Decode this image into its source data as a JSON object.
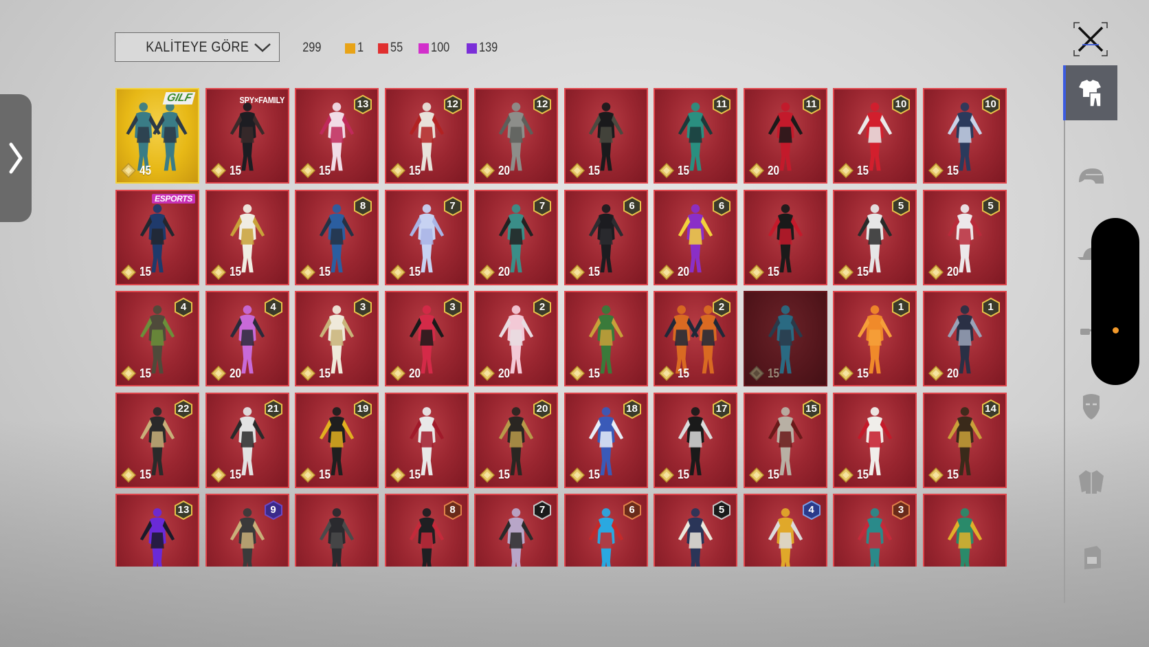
{
  "toolbar": {
    "sort_label": "KALİTEYE GÖRE",
    "total_count": "299",
    "rarity_counts": [
      {
        "color": "#e8a317",
        "count": "1"
      },
      {
        "color": "#e02f2f",
        "count": "55"
      },
      {
        "color": "#d22fcb",
        "count": "100"
      },
      {
        "color": "#7b2fd8",
        "count": "139"
      }
    ]
  },
  "sidebar": {
    "categories": [
      {
        "name": "outfit-icon",
        "active": true
      },
      {
        "name": "helmet-icon",
        "active": false
      },
      {
        "name": "cap-icon",
        "active": false
      },
      {
        "name": "glasses-icon",
        "active": false
      },
      {
        "name": "mask-icon",
        "active": false
      },
      {
        "name": "jacket-icon",
        "active": false
      },
      {
        "name": "backpack-icon",
        "active": false
      }
    ]
  },
  "outfits": [
    {
      "tag": "GILF",
      "tag_type": "gilf",
      "price": "45",
      "style": "gold",
      "colors": [
        "#3a7c86",
        "#2c3a48"
      ],
      "twin": true
    },
    {
      "tag": "SPY×FAMILY",
      "tag_type": "spy",
      "price": "15",
      "colors": [
        "#1d1d22",
        "#3a2a2a"
      ]
    },
    {
      "rank": "13",
      "price": "15",
      "colors": [
        "#f1dce6",
        "#c02a5a"
      ]
    },
    {
      "rank": "12",
      "price": "15",
      "colors": [
        "#e8e2da",
        "#b22222"
      ]
    },
    {
      "rank": "12",
      "price": "20",
      "colors": [
        "#8d8e8a",
        "#5d5f5a"
      ]
    },
    {
      "price": "15",
      "colors": [
        "#1a1a1c",
        "#4a4a40"
      ]
    },
    {
      "rank": "11",
      "price": "15",
      "colors": [
        "#2a8f80",
        "#1b3a3a"
      ]
    },
    {
      "rank": "11",
      "price": "20",
      "colors": [
        "#c31a2b",
        "#1a1a1a"
      ]
    },
    {
      "rank": "10",
      "price": "15",
      "colors": [
        "#d21f2d",
        "#eaeaea"
      ]
    },
    {
      "rank": "10",
      "price": "15",
      "colors": [
        "#2b3a5c",
        "#c8d3e8"
      ]
    },
    {
      "tag": "ESPORTS",
      "tag_type": "esports",
      "price": "15",
      "colors": [
        "#1f3a6b",
        "#22272f"
      ]
    },
    {
      "price": "15",
      "colors": [
        "#f0ece2",
        "#c9a23a"
      ]
    },
    {
      "rank": "8",
      "price": "15",
      "colors": [
        "#2b5ea0",
        "#243245"
      ]
    },
    {
      "rank": "7",
      "price": "15",
      "colors": [
        "#c7d2f2",
        "#a9b5e6"
      ]
    },
    {
      "rank": "7",
      "price": "20",
      "colors": [
        "#3a8e88",
        "#222"
      ]
    },
    {
      "rank": "6",
      "price": "15",
      "colors": [
        "#1c1c20",
        "#2c2c30"
      ]
    },
    {
      "rank": "6",
      "price": "20",
      "colors": [
        "#8a2fc7",
        "#f2d23c"
      ]
    },
    {
      "price": "15",
      "colors": [
        "#1a1a1a",
        "#c41a2b"
      ]
    },
    {
      "rank": "5",
      "price": "15",
      "colors": [
        "#e6e6e6",
        "#2a2a2a"
      ]
    },
    {
      "rank": "5",
      "price": "20",
      "colors": [
        "#ece8ea",
        "#b82a3a"
      ]
    },
    {
      "rank": "4",
      "price": "15",
      "colors": [
        "#4f4a3a",
        "#6b8f3a"
      ]
    },
    {
      "rank": "4",
      "price": "20",
      "colors": [
        "#c86ad8",
        "#2a2a3a"
      ]
    },
    {
      "rank": "3",
      "price": "15",
      "colors": [
        "#efe9da",
        "#c9b47a"
      ]
    },
    {
      "rank": "3",
      "price": "20",
      "colors": [
        "#d42a48",
        "#1a1a1a"
      ]
    },
    {
      "rank": "2",
      "price": "20",
      "colors": [
        "#f3c9d6",
        "#e8dde2"
      ]
    },
    {
      "price": "15",
      "colors": [
        "#3a7a3a",
        "#c9a03a"
      ]
    },
    {
      "rank": "2",
      "price": "15",
      "colors": [
        "#d96a22",
        "#1f2838"
      ],
      "twin": true
    },
    {
      "price": "15",
      "style": "dim",
      "colors": [
        "#2a6a82",
        "#2a3a4a"
      ]
    },
    {
      "rank": "1",
      "price": "15",
      "colors": [
        "#f08a2a",
        "#f6a03a"
      ]
    },
    {
      "rank": "1",
      "price": "20",
      "colors": [
        "#2a3045",
        "#9aa3b8"
      ]
    },
    {
      "rank": "22",
      "price": "15",
      "colors": [
        "#2a2a2a",
        "#c9b07a"
      ]
    },
    {
      "rank": "21",
      "price": "15",
      "colors": [
        "#e2e2e2",
        "#2a2a2a"
      ]
    },
    {
      "rank": "19",
      "price": "15",
      "colors": [
        "#1f1f1f",
        "#e2b020"
      ]
    },
    {
      "price": "15",
      "colors": [
        "#e8e8e8",
        "#a01a2a"
      ]
    },
    {
      "rank": "20",
      "price": "15",
      "colors": [
        "#2a2622",
        "#b89a4a"
      ]
    },
    {
      "rank": "18",
      "price": "15",
      "colors": [
        "#3a5ab8",
        "#e8eef8"
      ]
    },
    {
      "rank": "17",
      "price": "15",
      "colors": [
        "#1a1a1a",
        "#dcdcdc"
      ]
    },
    {
      "rank": "15",
      "price": "15",
      "colors": [
        "#b8b0a4",
        "#6a1a1a"
      ]
    },
    {
      "price": "15",
      "colors": [
        "#f0eeea",
        "#c41a2a"
      ]
    },
    {
      "rank": "14",
      "price": "15",
      "colors": [
        "#3a2a1a",
        "#c9a03a"
      ]
    },
    {
      "rank": "13",
      "colors": [
        "#6a2ad8",
        "#1a1a2a"
      ]
    },
    {
      "rank": "9",
      "rank_style": "purple",
      "colors": [
        "#3a3a3a",
        "#c9b07a"
      ]
    },
    {
      "colors": [
        "#2a2a2e",
        "#4a4a4a"
      ]
    },
    {
      "rank": "8",
      "rank_style": "red",
      "colors": [
        "#1f1f22",
        "#c42a3a"
      ]
    },
    {
      "rank": "7",
      "rank_style": "dark",
      "colors": [
        "#b8a6c8",
        "#2a2a2a"
      ]
    },
    {
      "rank": "6",
      "rank_style": "red",
      "colors": [
        "#2aa8e0",
        "#c42a2a"
      ]
    },
    {
      "rank": "5",
      "rank_style": "dark",
      "colors": [
        "#2a3558",
        "#ece8dc"
      ]
    },
    {
      "rank": "4",
      "rank_style": "blue",
      "colors": [
        "#e0a82a",
        "#dcdcdc"
      ]
    },
    {
      "rank": "3",
      "rank_style": "red",
      "colors": [
        "#2a8a8a",
        "#c42a3a"
      ]
    },
    {
      "colors": [
        "#2a8a6a",
        "#e0b02a"
      ]
    }
  ]
}
